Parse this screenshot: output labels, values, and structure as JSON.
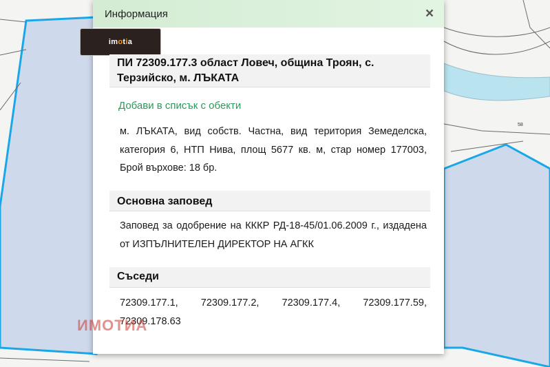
{
  "popup": {
    "title": "Информация",
    "close_icon": "×",
    "logo_text": "imotia",
    "parcel_title": "ПИ 72309.177.3 област Ловеч, община Троян, с. Терзийско, м. ЛЪКАТА",
    "add_link": "Добави в списък с обекти",
    "description": "м. ЛЪКАТА, вид собств. Частна, вид територия Земеделска, категория 6, НТП Нива, площ 5677 кв. м, стар номер 177003, Брой върхове: 18 бр.",
    "order_heading": "Основна заповед",
    "order_text": "Заповед за одобрение на КККР РД-18-45/01.06.2009 г., издадена от ИЗПЪЛНИТЕЛЕН ДИРЕКТОР НА АГКК",
    "neighbors_heading": "Съседи",
    "neighbors_text": "72309.177.1, 72309.177.2, 72309.177.4, 72309.177.59, 72309.178.63"
  },
  "map": {
    "parcel_number_label": "58",
    "parcel_fill": "#cfd9ec",
    "parcel_border": "#1aa7e8",
    "river_color": "#b9e4ef"
  },
  "watermark": "ИМОТИА"
}
